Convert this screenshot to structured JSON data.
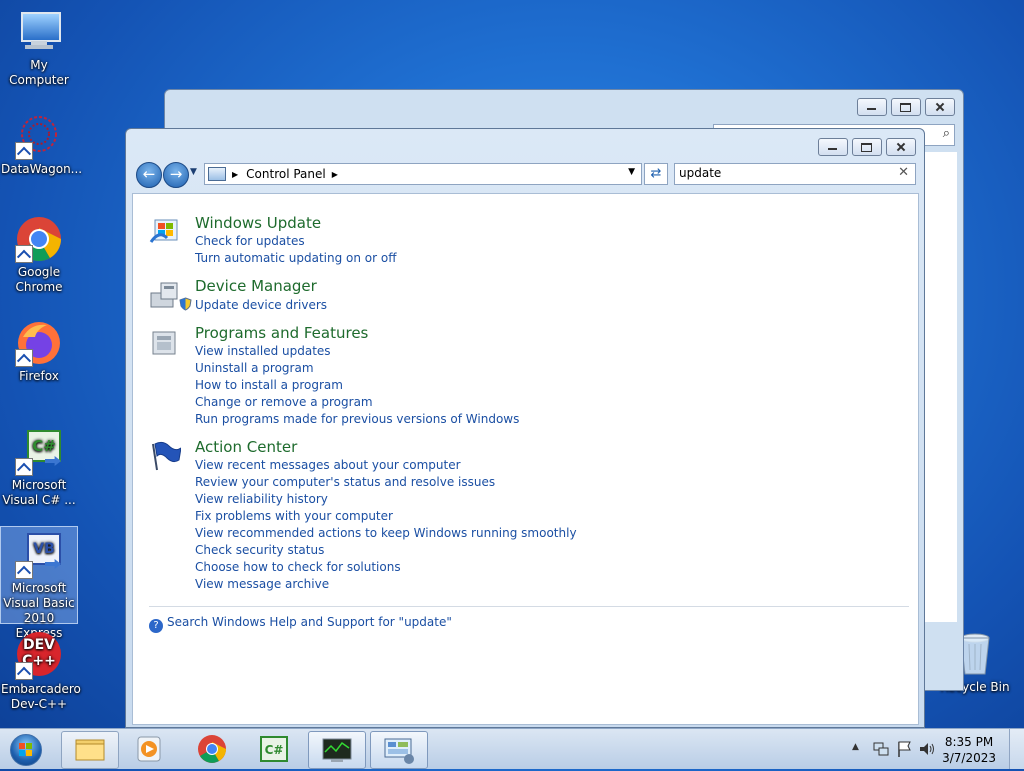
{
  "desktop": {
    "icons": [
      {
        "label": "My Computer"
      },
      {
        "label": "DataWagon..."
      },
      {
        "label": "Google Chrome"
      },
      {
        "label": "Firefox"
      },
      {
        "label": "Microsoft Visual C# ..."
      },
      {
        "label": "Microsoft Visual Basic 2010 Express"
      },
      {
        "label": "Embarcadero Dev-C++"
      },
      {
        "label": "Recycle Bin"
      }
    ]
  },
  "window": {
    "breadcrumb": [
      "Control Panel"
    ],
    "search_value": "update",
    "groups": [
      {
        "title": "Windows Update",
        "links": [
          "Check for updates",
          "Turn automatic updating on or off"
        ]
      },
      {
        "title": "Device Manager",
        "links": [
          "Update device drivers"
        ]
      },
      {
        "title": "Programs and Features",
        "links": [
          "View installed updates",
          "Uninstall a program",
          "How to install a program",
          "Change or remove a program",
          "Run programs made for previous versions of Windows"
        ]
      },
      {
        "title": "Action Center",
        "links": [
          "View recent messages about your computer",
          "Review your computer's status and resolve issues",
          "View reliability history",
          "Fix problems with your computer",
          "View recommended actions to keep Windows running smoothly",
          "Check security status",
          "Choose how to check for solutions",
          "View message archive"
        ]
      }
    ],
    "help_link": "Search Windows Help and Support for \"update\""
  },
  "taskbar": {
    "time": "8:35 PM",
    "date": "3/7/2023"
  }
}
